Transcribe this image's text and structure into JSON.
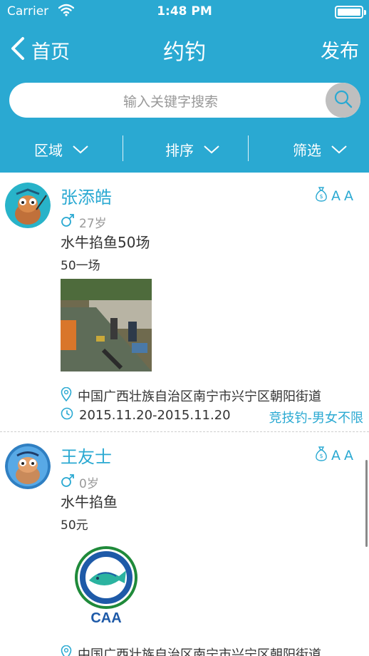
{
  "status_bar": {
    "carrier": "Carrier",
    "time": "1:48 PM"
  },
  "nav": {
    "back_label": "首页",
    "title": "约钓",
    "right_label": "发布"
  },
  "search": {
    "placeholder": "输入关键字搜索"
  },
  "filters": [
    {
      "label": "区域"
    },
    {
      "label": "排序"
    },
    {
      "label": "筛选"
    }
  ],
  "colors": {
    "accent": "#2aa9d2"
  },
  "posts": [
    {
      "name": "张添皓",
      "badge_letters": [
        "A",
        "A"
      ],
      "badge_icon": "money-bag-icon",
      "gender_icon": "male-icon",
      "age": "27岁",
      "title": "水牛掐鱼50场",
      "price": "50一场",
      "location": "中国广西壮族自治区南宁市兴宁区朝阳街道",
      "date_range": "2015.11.20-2015.11.20",
      "category": "竞技钓-男女不限"
    },
    {
      "name": "王友士",
      "badge_letters": [
        "A",
        "A"
      ],
      "badge_icon": "money-bag-icon",
      "gender_icon": "male-icon",
      "age": "0岁",
      "title": "水牛掐鱼",
      "price": "50元",
      "image_caption": "CAA",
      "location": "中国广西壮族自治区南宁市兴宁区朝阳街道"
    }
  ]
}
